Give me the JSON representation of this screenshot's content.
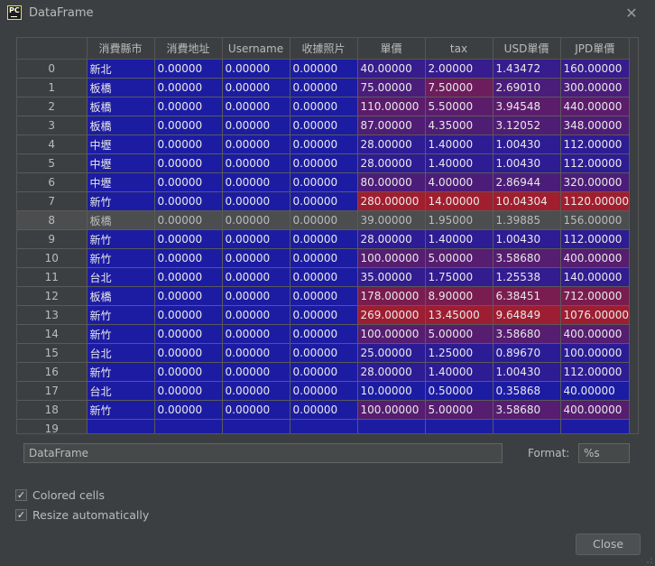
{
  "window": {
    "title": "DataFrame",
    "close_glyph": "✕",
    "app_icon_text": "PC"
  },
  "table": {
    "columns": [
      "",
      "消費縣市",
      "消費地址",
      "Username",
      "收據照片",
      "單價",
      "tax",
      "USD單價",
      "JPD單價"
    ],
    "selected_row": 8,
    "rows": [
      [
        "0",
        "新北",
        "0.00000",
        "0.00000",
        "0.00000",
        "40.00000",
        "2.00000",
        "1.43472",
        "160.00000"
      ],
      [
        "1",
        "板橋",
        "0.00000",
        "0.00000",
        "0.00000",
        "75.00000",
        "7.50000",
        "2.69010",
        "300.00000"
      ],
      [
        "2",
        "板橋",
        "0.00000",
        "0.00000",
        "0.00000",
        "110.00000",
        "5.50000",
        "3.94548",
        "440.00000"
      ],
      [
        "3",
        "板橋",
        "0.00000",
        "0.00000",
        "0.00000",
        "87.00000",
        "4.35000",
        "3.12052",
        "348.00000"
      ],
      [
        "4",
        "中壢",
        "0.00000",
        "0.00000",
        "0.00000",
        "28.00000",
        "1.40000",
        "1.00430",
        "112.00000"
      ],
      [
        "5",
        "中壢",
        "0.00000",
        "0.00000",
        "0.00000",
        "28.00000",
        "1.40000",
        "1.00430",
        "112.00000"
      ],
      [
        "6",
        "中壢",
        "0.00000",
        "0.00000",
        "0.00000",
        "80.00000",
        "4.00000",
        "2.86944",
        "320.00000"
      ],
      [
        "7",
        "新竹",
        "0.00000",
        "0.00000",
        "0.00000",
        "280.00000",
        "14.00000",
        "10.04304",
        "1120.00000"
      ],
      [
        "8",
        "板橋",
        "0.00000",
        "0.00000",
        "0.00000",
        "39.00000",
        "1.95000",
        "1.39885",
        "156.00000"
      ],
      [
        "9",
        "新竹",
        "0.00000",
        "0.00000",
        "0.00000",
        "28.00000",
        "1.40000",
        "1.00430",
        "112.00000"
      ],
      [
        "10",
        "新竹",
        "0.00000",
        "0.00000",
        "0.00000",
        "100.00000",
        "5.00000",
        "3.58680",
        "400.00000"
      ],
      [
        "11",
        "台北",
        "0.00000",
        "0.00000",
        "0.00000",
        "35.00000",
        "1.75000",
        "1.25538",
        "140.00000"
      ],
      [
        "12",
        "板橋",
        "0.00000",
        "0.00000",
        "0.00000",
        "178.00000",
        "8.90000",
        "6.38451",
        "712.00000"
      ],
      [
        "13",
        "新竹",
        "0.00000",
        "0.00000",
        "0.00000",
        "269.00000",
        "13.45000",
        "9.64849",
        "1076.00000"
      ],
      [
        "14",
        "新竹",
        "0.00000",
        "0.00000",
        "0.00000",
        "100.00000",
        "5.00000",
        "3.58680",
        "400.00000"
      ],
      [
        "15",
        "台北",
        "0.00000",
        "0.00000",
        "0.00000",
        "25.00000",
        "1.25000",
        "0.89670",
        "100.00000"
      ],
      [
        "16",
        "新竹",
        "0.00000",
        "0.00000",
        "0.00000",
        "28.00000",
        "1.40000",
        "1.00430",
        "112.00000"
      ],
      [
        "17",
        "台北",
        "0.00000",
        "0.00000",
        "0.00000",
        "10.00000",
        "0.50000",
        "0.35868",
        "40.00000"
      ],
      [
        "18",
        "新竹",
        "0.00000",
        "0.00000",
        "0.00000",
        "100.00000",
        "5.00000",
        "3.58680",
        "400.00000"
      ],
      [
        "19",
        "",
        "",
        "",
        "",
        "",
        "",
        "",
        ""
      ]
    ]
  },
  "colors": {
    "cold": "#1c1ca3",
    "hot": "#a11e2e",
    "selected": "#4b4d4f",
    "background": "#3c3f41"
  },
  "name_field": {
    "value": "DataFrame"
  },
  "format": {
    "label": "Format:",
    "value": "%s"
  },
  "options": {
    "colored_cells": {
      "label": "Colored cells",
      "checked": true
    },
    "resize_automatically": {
      "label": "Resize automatically",
      "checked": true
    }
  },
  "buttons": {
    "close_label": "Close"
  }
}
